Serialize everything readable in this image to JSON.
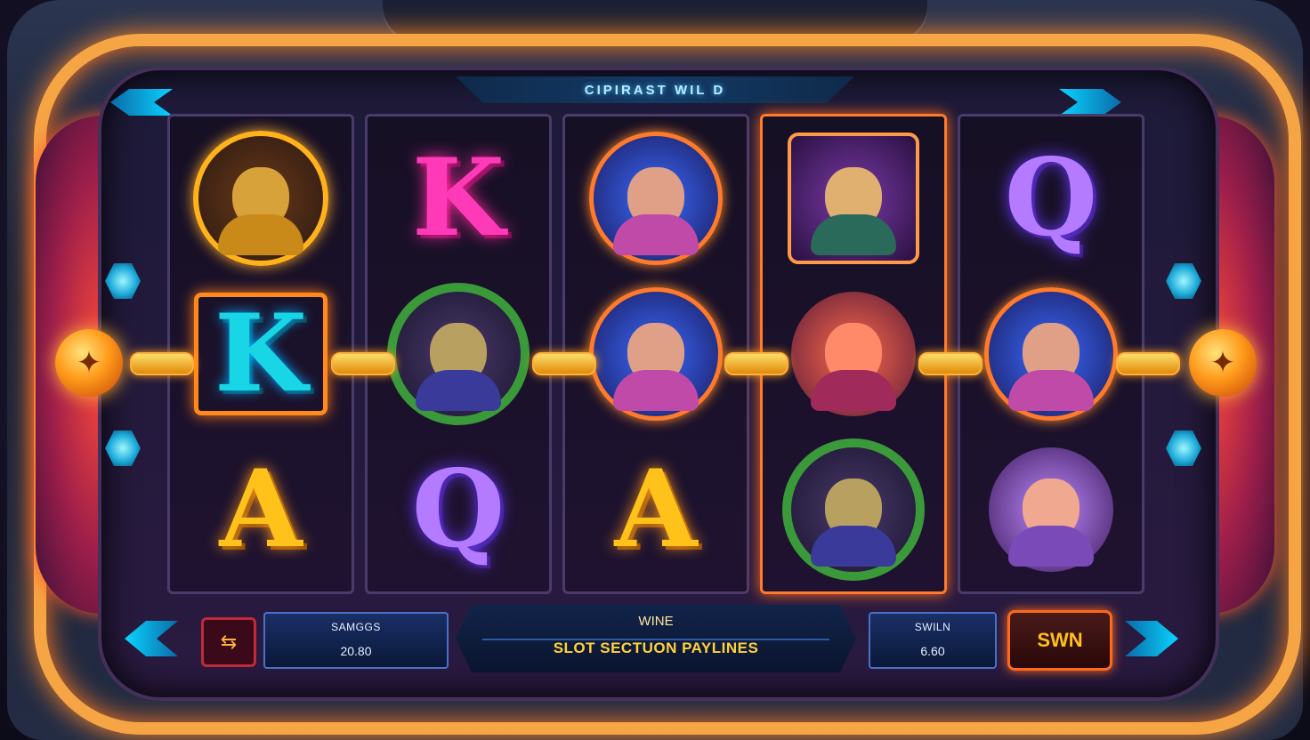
{
  "game": {
    "title": "CIPIRAST WIL D"
  },
  "reels": [
    {
      "symbols": [
        {
          "kind": "character",
          "name": "golden-warrior"
        },
        {
          "kind": "letter",
          "text": "K",
          "style": "cyan-framed"
        },
        {
          "kind": "letter",
          "text": "A",
          "style": "gold"
        }
      ]
    },
    {
      "symbols": [
        {
          "kind": "letter",
          "text": "K",
          "style": "magenta"
        },
        {
          "kind": "character",
          "name": "green-wreath-elder"
        },
        {
          "kind": "letter",
          "text": "Q",
          "style": "purple"
        }
      ]
    },
    {
      "symbols": [
        {
          "kind": "character",
          "name": "diva-frame"
        },
        {
          "kind": "character",
          "name": "diva-frame"
        },
        {
          "kind": "letter",
          "text": "A",
          "style": "gold"
        }
      ]
    },
    {
      "symbols": [
        {
          "kind": "character",
          "name": "brute-wild"
        },
        {
          "kind": "character",
          "name": "fire-dancer"
        },
        {
          "kind": "character",
          "name": "green-wreath-elder"
        }
      ]
    },
    {
      "symbols": [
        {
          "kind": "letter",
          "text": "Q",
          "style": "purple"
        },
        {
          "kind": "character",
          "name": "diva-frame"
        },
        {
          "kind": "character",
          "name": "pink-creature"
        }
      ]
    }
  ],
  "controls": {
    "left_box": {
      "label": "SAMGGS",
      "value": "20.80"
    },
    "center": {
      "top": "WINE",
      "bottom": "SLOT SECTUON PAYLINES"
    },
    "right_box": {
      "label": "SWILN",
      "value": "6.60"
    },
    "spin_label": "SWN",
    "menu_icon": "menu-icon"
  },
  "colors": {
    "frame_glow": "#f6a544",
    "accent_cyan": "#0ad4ff",
    "payline_gold": "#ffb13a"
  }
}
